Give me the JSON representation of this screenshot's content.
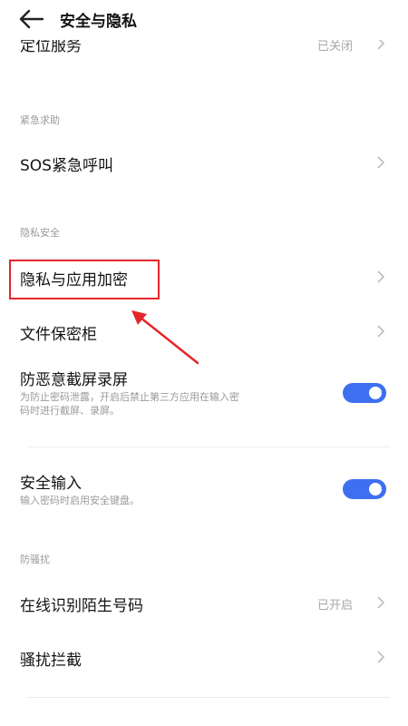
{
  "header": {
    "title": "安全与隐私"
  },
  "location": {
    "label": "定位服务",
    "status": "已关闭"
  },
  "sections": {
    "emergency": "紧急求助",
    "privacy": "隐私安全",
    "harassment": "防骚扰"
  },
  "sos": {
    "label": "SOS紧急呼叫"
  },
  "privacy_encrypt": {
    "label": "隐私与应用加密"
  },
  "file_safe": {
    "label": "文件保密柜"
  },
  "anti_screenshot": {
    "label": "防恶意截屏录屏",
    "desc_line1": "为防止密码泄露，开启后禁止第三方应用在输入密",
    "desc_line2": "码时进行截屏、录屏。",
    "enabled": true
  },
  "secure_input": {
    "label": "安全输入",
    "desc": "输入密码时启用安全键盘。",
    "enabled": true
  },
  "stranger_id": {
    "label": "在线识别陌生号码",
    "status": "已开启"
  },
  "harass_block": {
    "label": "骚扰拦截"
  },
  "colors": {
    "toggle_on": "#3e6ff0",
    "highlight": "#e4262a"
  }
}
